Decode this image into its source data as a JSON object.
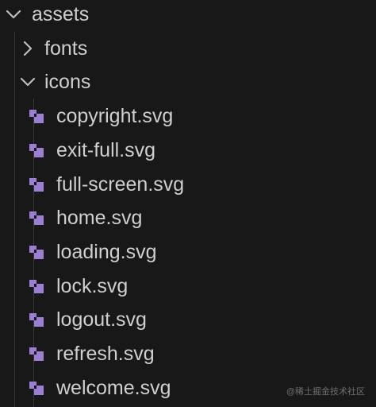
{
  "explorer": {
    "root": {
      "label": "assets",
      "expanded": true
    },
    "folders": [
      {
        "label": "fonts",
        "expanded": false
      },
      {
        "label": "icons",
        "expanded": true
      }
    ],
    "files": [
      {
        "label": "copyright.svg"
      },
      {
        "label": "exit-full.svg"
      },
      {
        "label": "full-screen.svg"
      },
      {
        "label": "home.svg"
      },
      {
        "label": "loading.svg"
      },
      {
        "label": "lock.svg"
      },
      {
        "label": "logout.svg"
      },
      {
        "label": "refresh.svg"
      },
      {
        "label": "welcome.svg"
      }
    ]
  },
  "watermark": "@稀土掘金技术社区",
  "colors": {
    "background": "#181818",
    "text": "#cfcfcf",
    "svg_icon": "#9b7fd1",
    "chevron": "#bdbdbd",
    "indent_guide": "#3a3a3a"
  },
  "icons": {
    "collapsed": "chevron-right-icon",
    "expanded": "chevron-down-icon",
    "file": "svg-file-icon"
  }
}
